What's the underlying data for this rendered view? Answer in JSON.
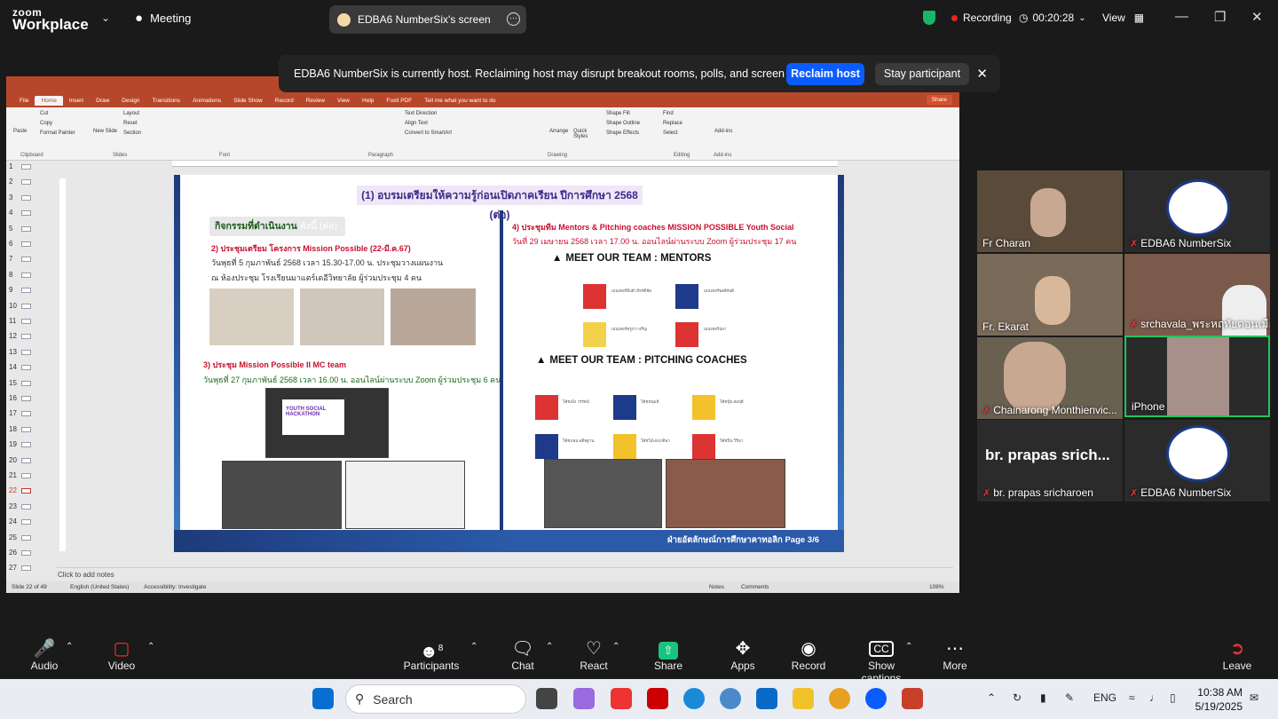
{
  "topbar": {
    "brand_top": "zoom",
    "brand_bottom": "Workplace",
    "meeting_label": "Meeting",
    "screen_share_label": "EDBA6 NumberSix's screen",
    "recording_label": "Recording",
    "timer": "00:20:28",
    "view_label": "View"
  },
  "banner": {
    "message": "EDBA6 NumberSix is currently host. Reclaiming host may disrupt breakout rooms, polls, and screen share",
    "reclaim": "Reclaim host",
    "stay": "Stay participant"
  },
  "ppt": {
    "tabs": [
      "File",
      "Home",
      "Insert",
      "Draw",
      "Design",
      "Transitions",
      "Animations",
      "Slide Show",
      "Record",
      "Review",
      "View",
      "Help",
      "Foxit PDF"
    ],
    "tell_me": "Tell me what you want to do",
    "share": "Share",
    "ribbon": {
      "paste": "Paste",
      "cut": "Cut",
      "copy": "Copy",
      "format_painter": "Format Painter",
      "new_slide": "New Slide",
      "layout": "Layout",
      "reset": "Reset",
      "section": "Section",
      "text_direction": "Text Direction",
      "align_text": "Align Text",
      "convert_smartart": "Convert to SmartArt",
      "arrange": "Arrange",
      "quick_styles": "Quick Styles",
      "shape_fill": "Shape Fill",
      "shape_outline": "Shape Outline",
      "shape_effects": "Shape Effects",
      "find": "Find",
      "replace": "Replace",
      "select": "Select",
      "addins": "Add-ins",
      "groups": [
        "Clipboard",
        "Slides",
        "Font",
        "Paragraph",
        "Drawing",
        "Editing",
        "Add-ins"
      ]
    },
    "slide_numbers": [
      "1",
      "2",
      "3",
      "4",
      "5",
      "6",
      "7",
      "8",
      "9",
      "10",
      "11",
      "12",
      "13",
      "14",
      "15",
      "16",
      "17",
      "18",
      "19",
      "20",
      "21",
      "22",
      "23",
      "24",
      "25",
      "26",
      "27"
    ],
    "current_slide": "22",
    "notes_placeholder": "Click to add notes",
    "status": {
      "slide_of": "Slide 22 of 49",
      "language": "English (United States)",
      "accessibility": "Accessibility: Investigate",
      "notes": "Notes",
      "comments": "Comments",
      "zoom": "108%"
    },
    "slide": {
      "header": "(1)   อบรมเตรียมให้ความรู้ก่อนเปิดภาคเรียน ปีการศึกษา 2568 (ต่อ)",
      "activity_title": "กิจกรรมที่ดำเนินงาน",
      "activity_suffix": "ดังนี้ (ต่อ)",
      "item2_title": "2) ประชุมเตรียม โครงการ Mission Possible (22-มี.ค.67)",
      "item2_line1": "วันพุธที่ 5 กุมภาพันธ์ 2568 เวลา 15.30-17.00 น. ประชุมวางแผนงาน",
      "item2_line2": "ณ ห้องประชุม โรงเรียนมาแตร์เดอีวิทยาลัย ผู้ร่วมประชุม 4 คน",
      "item3_title": "3) ประชุม Mission Possible II MC team",
      "item3_line": "วันพุธที่ 27 กุมภาพันธ์ 2568 เวลา 16.00 น. ออนไลน์ผ่านระบบ Zoom ผู้ร่วมประชุม 6 คน",
      "hackathon": "YOUTH SOCIAL HACKATHON",
      "item4_title": "4) ประชุมทีม  Mentors & Pitching coaches  MISSION POSSIBLE Youth Social",
      "item4_line": "วันที่ 29 เมษายน  2568 เวลา 17.00 น. ออนไลน์ผ่านระบบ Zoom ผู้ร่วมประชุม 17 คน",
      "mentors_title": "MEET OUR TEAM : MENTORS",
      "coaches_title": "MEET OUR TEAM : PITCHING COACHES",
      "mentors": [
        "เมนเทอร์ธิบดี เกียรติชัย",
        "เมนเทอร์พงศ์สันติ",
        "เมนเทอร์ครูภา เจริญ",
        "เมนเทอร์ปลา"
      ],
      "coaches": [
        "โค้ชเมิง วรรัตน์",
        "โค้ชหนุ่มอี",
        "โค้ชปุ้ย สมฤดี",
        "โค้ชแพน อดิษฐาน",
        "โค้ชโอ๊ะธนาดิษา",
        "โค้ชปิ่น วิรินา"
      ],
      "footer": "ฝ่ายอัตลักษณ์การศึกษาคาทอลิก  Page 3/6"
    }
  },
  "gallery": [
    {
      "name": "Fr Charan",
      "muted": false
    },
    {
      "name": "EDBA6 NumberSix",
      "muted": true
    },
    {
      "name": "Fr. Ekarat",
      "muted": false
    },
    {
      "name": "srchavala_พระหฤทัยดอนเมือง",
      "muted": true
    },
    {
      "name": "Chainarong Monthienvic...",
      "muted": true
    },
    {
      "name": "iPhone",
      "muted": false
    },
    {
      "name": "br. prapas srichar...",
      "display": "br. prapas srich...",
      "muted": true,
      "label": "br. prapas sricharoen"
    },
    {
      "name": "EDBA6 NumberSix",
      "muted": true
    }
  ],
  "toolbar": {
    "audio": "Audio",
    "video": "Video",
    "participants": "Participants",
    "participants_count": "8",
    "chat": "Chat",
    "react": "React",
    "share": "Share",
    "apps": "Apps",
    "record": "Record",
    "captions": "Show captions",
    "more": "More",
    "leave": "Leave"
  },
  "taskbar": {
    "search": "Search",
    "lang": "ENG",
    "time": "10:38 AM",
    "date": "5/19/2025"
  },
  "colors": {
    "accent": "#0b5cff",
    "ppt": "#b7472a",
    "share_green": "#19c37d",
    "active_tile": "#22c55e"
  }
}
